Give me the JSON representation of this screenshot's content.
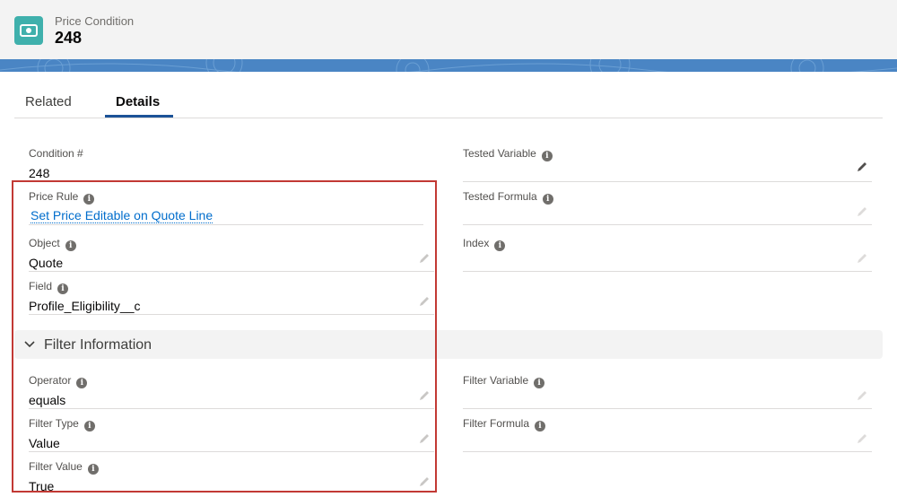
{
  "header": {
    "object_type": "Price Condition",
    "record_name": "248"
  },
  "tabs": [
    {
      "label": "Related",
      "active": false
    },
    {
      "label": "Details",
      "active": true
    }
  ],
  "fields": {
    "condition_number": {
      "label": "Condition #",
      "value": "248"
    },
    "tested_variable": {
      "label": "Tested Variable",
      "value": ""
    },
    "price_rule": {
      "label": "Price Rule",
      "value": "Set Price Editable on Quote Line"
    },
    "tested_formula": {
      "label": "Tested Formula",
      "value": ""
    },
    "object": {
      "label": "Object",
      "value": "Quote"
    },
    "index": {
      "label": "Index",
      "value": ""
    },
    "field": {
      "label": "Field",
      "value": "Profile_Eligibility__c"
    }
  },
  "filter_section": {
    "title": "Filter Information",
    "operator": {
      "label": "Operator",
      "value": "equals"
    },
    "filter_variable": {
      "label": "Filter Variable",
      "value": ""
    },
    "filter_type": {
      "label": "Filter Type",
      "value": "Value"
    },
    "filter_formula": {
      "label": "Filter Formula",
      "value": ""
    },
    "filter_value": {
      "label": "Filter Value",
      "value": "True"
    }
  },
  "info_glyph": "i",
  "colors": {
    "icon_bg": "#3fb0ac",
    "highlight_box": "#c23934",
    "link": "#006dcc",
    "tab_accent": "#1b5297"
  }
}
